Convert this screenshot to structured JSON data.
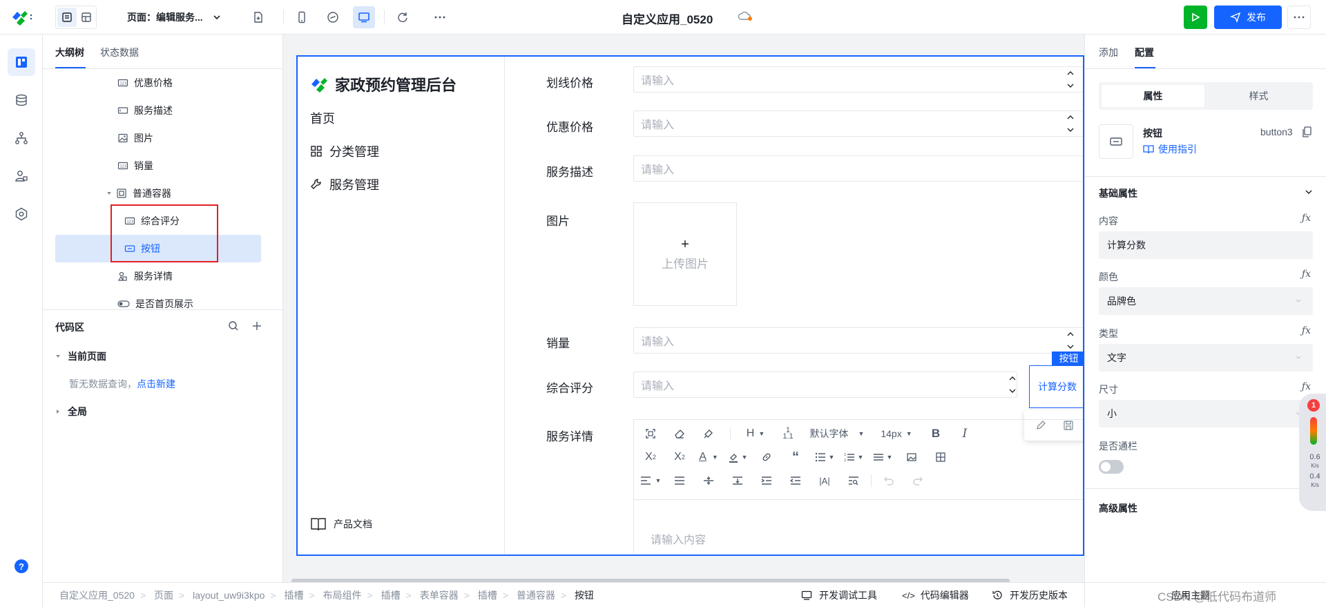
{
  "topbar": {
    "page_select_label": "页面：编辑服务...",
    "app_title": "自定义应用_0520",
    "publish_label": "发布",
    "accent": "#1664ff",
    "run_color": "#00b42a"
  },
  "outline": {
    "tabs": [
      "大纲树",
      "状态数据"
    ],
    "tree": [
      {
        "label": "优惠价格",
        "icon": "number-input-icon"
      },
      {
        "label": "服务描述",
        "icon": "text-input-icon"
      },
      {
        "label": "图片",
        "icon": "image-icon"
      },
      {
        "label": "销量",
        "icon": "number-input-icon"
      },
      {
        "label": "普通容器",
        "icon": "container-icon"
      },
      {
        "label": "综合评分",
        "icon": "number-input-icon"
      },
      {
        "label": "按钮",
        "icon": "button-icon"
      },
      {
        "label": "服务详情",
        "icon": "component-icon"
      },
      {
        "label": "是否首页展示",
        "icon": "switch-icon"
      }
    ],
    "code_area": {
      "title": "代码区",
      "current_page": "当前页面",
      "empty_text": "暂无数据查询，",
      "create_link": "点击新建",
      "global": "全局"
    }
  },
  "app": {
    "brand": "家政预约管理后台",
    "menu": [
      "首页",
      "分类管理",
      "服务管理"
    ],
    "doc_link": "产品文档"
  },
  "form": {
    "placeholder": "请输入",
    "fields": {
      "strike_price": "划线价格",
      "discount_price": "优惠价格",
      "description": "服务描述",
      "image": "图片",
      "sales": "销量",
      "rating": "综合评分",
      "detail": "服务详情"
    },
    "upload_label": "上传图片",
    "button_tag": "按钮",
    "calc_button": "计算分数",
    "rte": {
      "font": "默认字体",
      "size": "14px",
      "placeholder": "请输入内容"
    }
  },
  "right_panel": {
    "tabs": [
      "添加",
      "配置"
    ],
    "seg": [
      "属性",
      "样式"
    ],
    "component_name": "按钮",
    "component_id": "button3",
    "guide_link": "使用指引",
    "basic_section": "基础属性",
    "props": {
      "content_label": "内容",
      "content_value": "计算分数",
      "color_label": "颜色",
      "color_value": "品牌色",
      "type_label": "类型",
      "type_value": "文字",
      "size_label": "尺寸",
      "size_value": "小",
      "block_label": "是否通栏"
    },
    "advanced_section": "高级属性",
    "notification_count": "1",
    "meter": {
      "top": "0.6",
      "top_unit": "K/s",
      "bottom": "0.4",
      "bottom_unit": "K/s"
    }
  },
  "breadcrumb": [
    "自定义应用_0520",
    "页面",
    "layout_uw9i3kpo",
    "插槽",
    "布局组件",
    "插槽",
    "表单容器",
    "插槽",
    "普通容器",
    "按钮"
  ],
  "bottom_actions": {
    "debug": "开发调试工具",
    "code_editor": "代码编辑器",
    "history": "开发历史版本",
    "theme": "应用主题",
    "watermark": "CSDN @低代码布道师"
  }
}
